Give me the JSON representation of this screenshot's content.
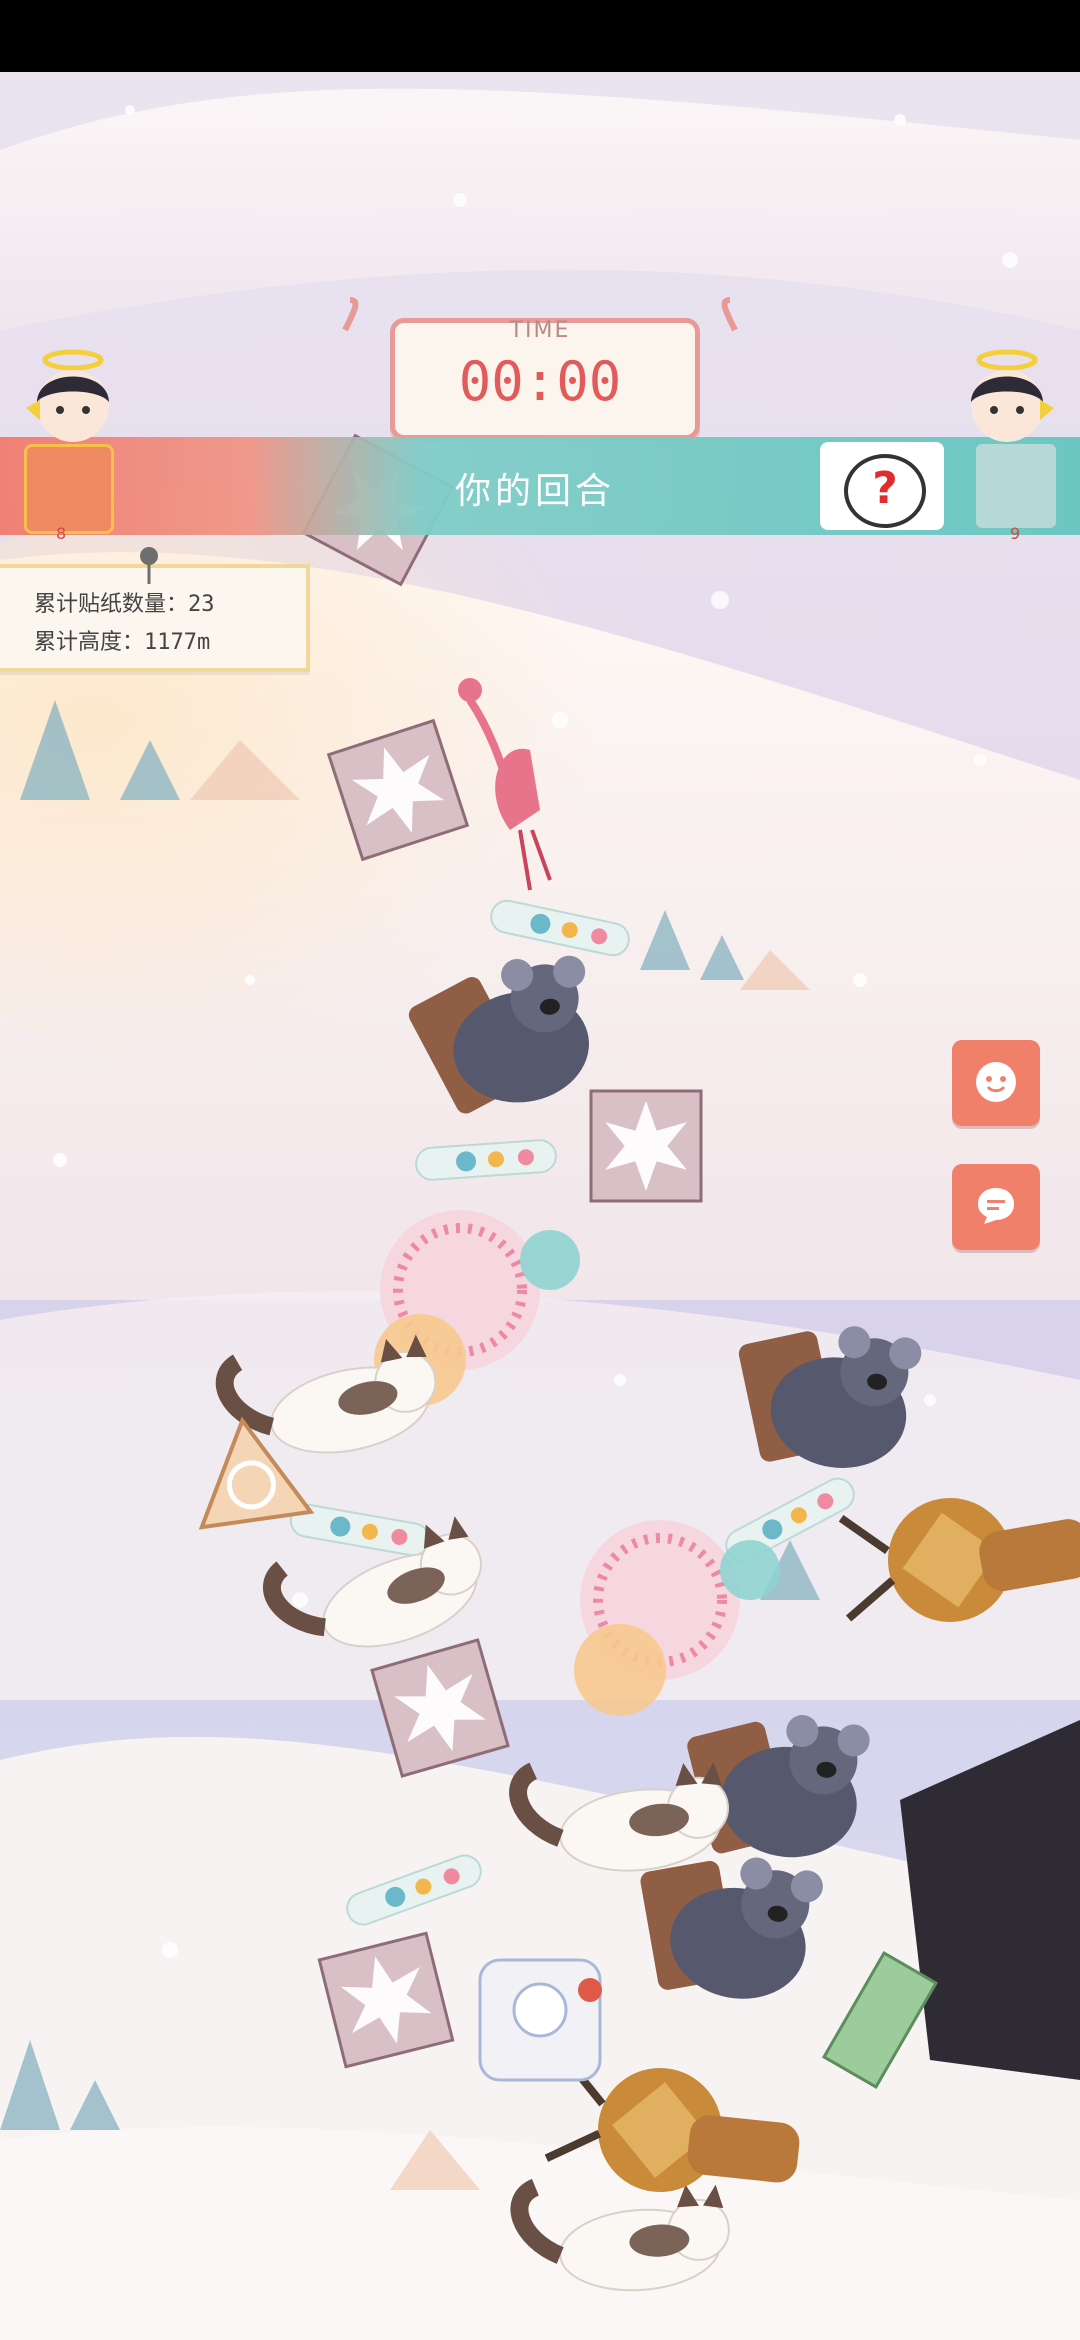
{
  "hud": {
    "timer": {
      "label": "TIME",
      "value": "00:00"
    },
    "turn_banner": {
      "label": "你的回合",
      "help_icon": "question-mark-icon"
    },
    "players": {
      "left": {
        "number": "8"
      },
      "right": {
        "number": "9"
      }
    },
    "stats": {
      "sticker_count": "累计贴纸数量：23",
      "height": "累计高度：1177m"
    },
    "side_buttons": [
      {
        "icon": "emoji-icon"
      },
      {
        "icon": "chat-icon"
      }
    ]
  },
  "colors": {
    "banner_left": "#f07b6f",
    "banner_right": "#6cc7c2",
    "timer_digits": "#e35a5a",
    "side_button": "#f1806b",
    "sticker_tile": "#d8c1c8"
  }
}
